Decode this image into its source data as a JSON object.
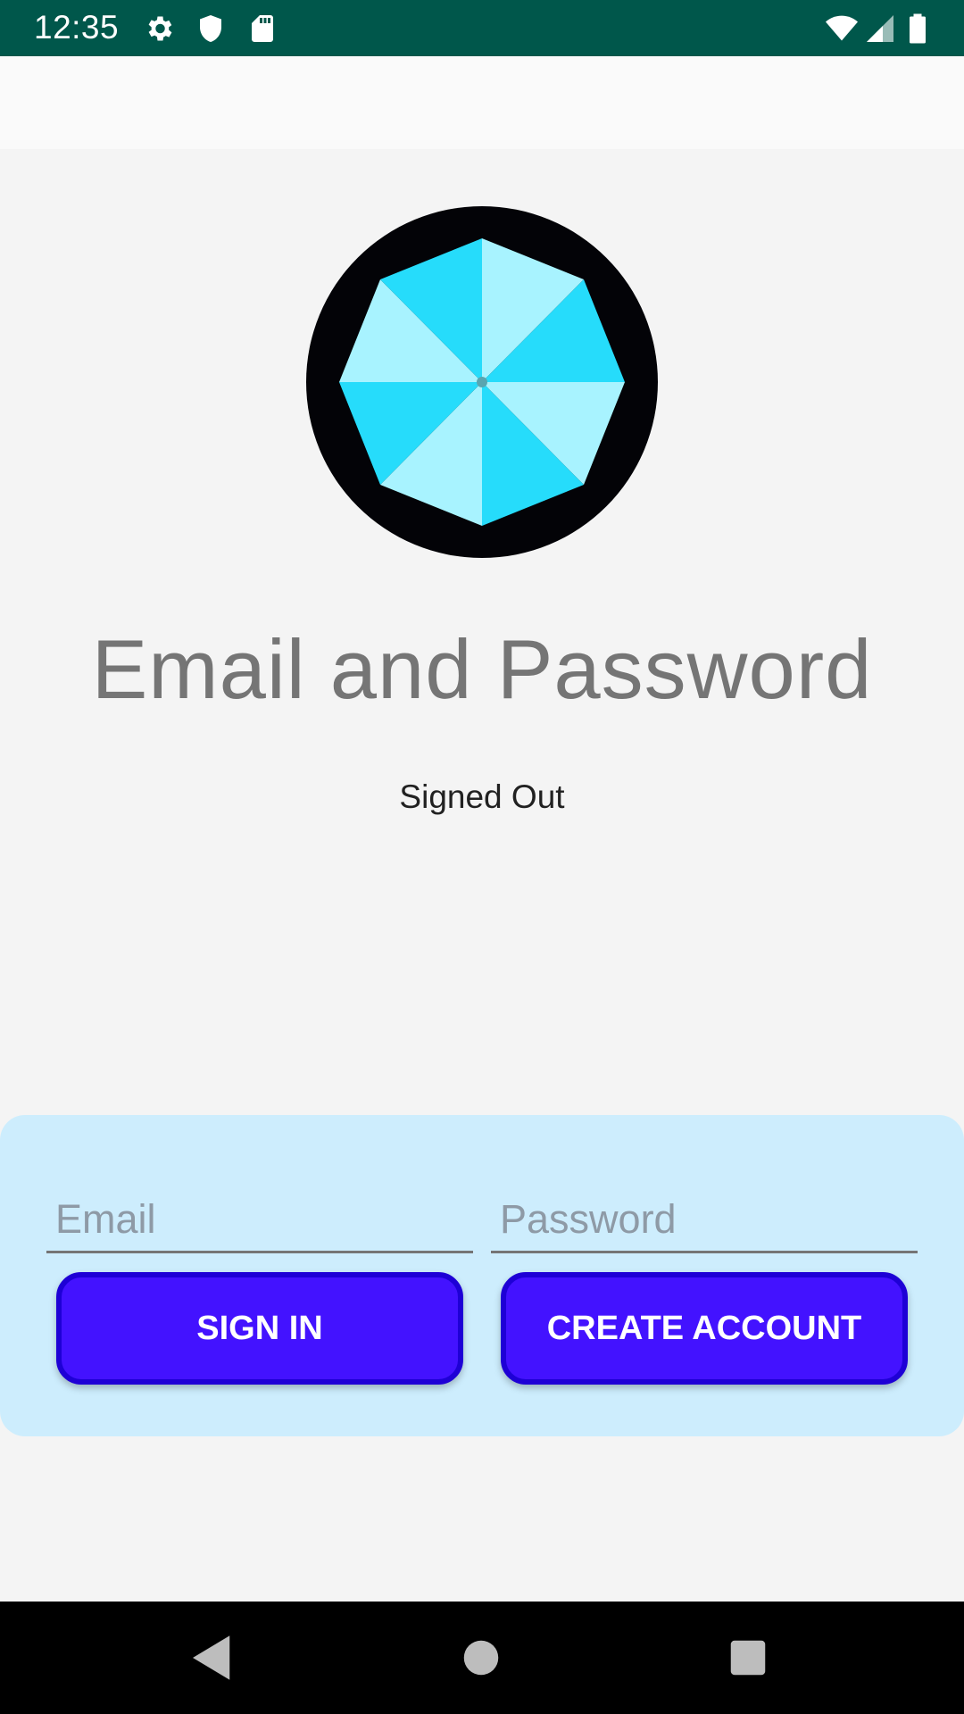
{
  "status_bar": {
    "time": "12:35",
    "icons": [
      "gear-icon",
      "shield-icon",
      "sd-card-icon",
      "wifi-icon",
      "signal-icon",
      "battery-icon"
    ]
  },
  "colors": {
    "status_bar": "#00574b",
    "panel": "#cdedfd",
    "button": "#4312ff",
    "button_border": "#1e00d6",
    "logo_light": "#a8f3ff",
    "logo_dark": "#26dcfb"
  },
  "main": {
    "title": "Email and Password",
    "status": "Signed Out"
  },
  "form": {
    "email_placeholder": "Email",
    "password_placeholder": "Password",
    "sign_in_label": "SIGN IN",
    "create_account_label": "CREATE ACCOUNT"
  },
  "nav_bar": {
    "icons": [
      "back-icon",
      "home-icon",
      "recents-icon"
    ]
  }
}
